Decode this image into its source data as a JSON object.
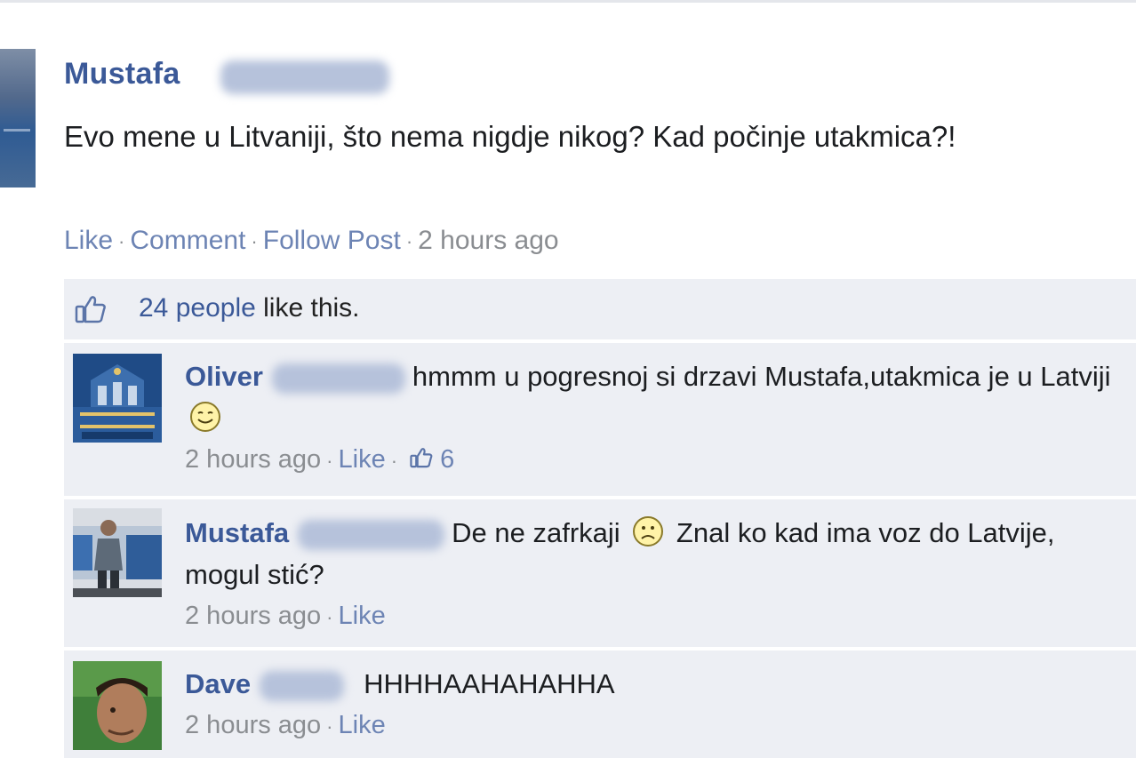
{
  "post": {
    "author": "Mustafa",
    "text": "Evo mene u Litvaniji, što nema nigdje nikog? Kad počinje utakmica?!",
    "actions": {
      "like": "Like",
      "comment": "Comment",
      "follow": "Follow Post",
      "time": "2 hours ago"
    },
    "likes_text_count": "24 people",
    "likes_text_rest": "like this."
  },
  "comments": [
    {
      "author": "Oliver",
      "text": "hmmm u pogresnoj si drzavi Mustafa,utakmica je u Latviji",
      "time": "2 hours ago",
      "like": "Like",
      "like_count": "6"
    },
    {
      "author": "Mustafa",
      "text_before": "De ne zafrkaji",
      "text_after": "Znal ko kad ima voz do Latvije, mogul stić?",
      "time": "2 hours ago",
      "like": "Like"
    },
    {
      "author": "Dave",
      "text": "HHHHAAHAHAHHA",
      "time": "2 hours ago",
      "like": "Like"
    }
  ],
  "colors": {
    "link": "#3b5998",
    "action_link": "#6d84b4",
    "muted": "#8a8d91",
    "comment_bg": "#edeff4"
  },
  "icons": [
    "like-thumb-icon",
    "smile-emoticon-icon",
    "frown-emoticon-icon"
  ]
}
